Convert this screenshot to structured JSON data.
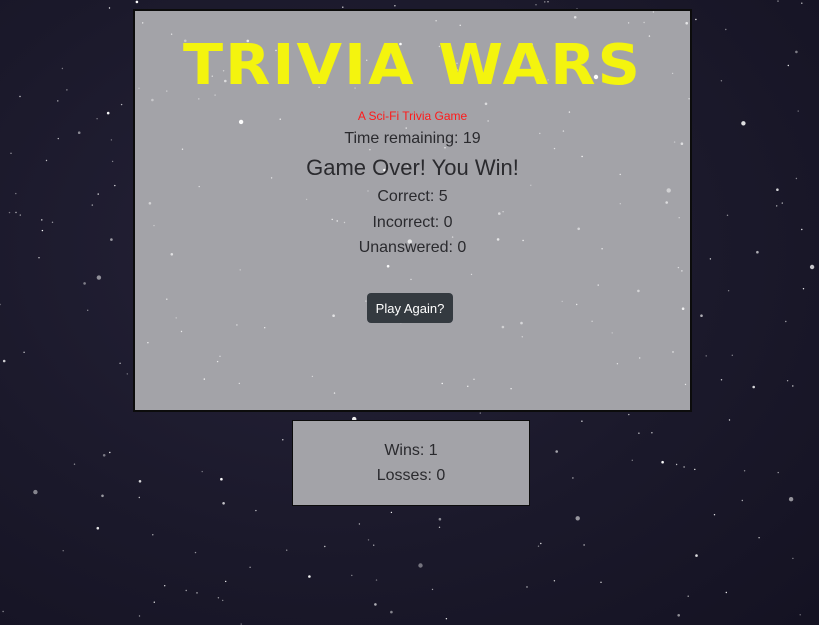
{
  "game": {
    "title": "TRIVIA WARS",
    "subtitle": "A Sci-Fi Trivia Game",
    "timer_text": "Time remaining: 19",
    "result_text": "Game Over! You Win!",
    "correct_text": "Correct: 5",
    "incorrect_text": "Incorrect: 0",
    "unanswered_text": "Unanswered: 0",
    "play_again_label": "Play Again?"
  },
  "scoreboard": {
    "wins_text": "Wins: 1",
    "losses_text": "Losses: 0"
  },
  "colors": {
    "background": "#1b192b",
    "panel": "#a3a3a8",
    "title": "#f4f40e",
    "subtitle": "#ff1a1a",
    "button": "#343a40"
  }
}
